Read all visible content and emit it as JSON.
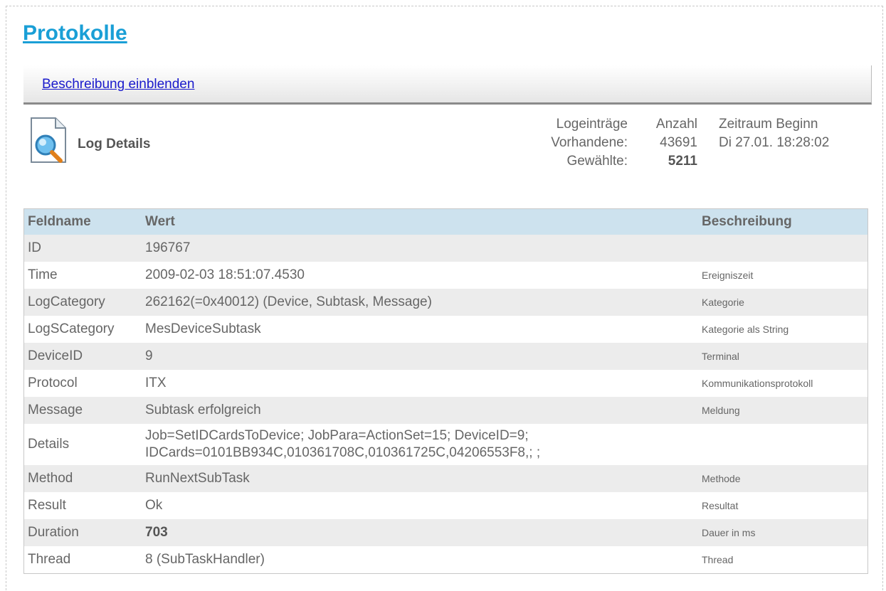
{
  "page": {
    "title": "Protokolle"
  },
  "description_toggle": {
    "label": "Beschreibung einblenden"
  },
  "log_details": {
    "title": "Log Details"
  },
  "stats": {
    "logeintraege_header": "Logeinträge",
    "anzahl_header": "Anzahl",
    "zeitraum_header": "Zeitraum Beginn",
    "vorhandene_label": "Vorhandene:",
    "vorhandene_count": "43691",
    "zeitraum_value": "Di 27.01. 18:28:02",
    "gewaehlte_label": "Gewählte:",
    "gewaehlte_count": "5211"
  },
  "table": {
    "headers": [
      "Feldname",
      "Wert",
      "Beschreibung"
    ],
    "rows": [
      {
        "field": "ID",
        "value": "196767",
        "description": ""
      },
      {
        "field": "Time",
        "value": "2009-02-03 18:51:07.4530",
        "description": "Ereigniszeit"
      },
      {
        "field": "LogCategory",
        "value": "262162(=0x40012) (Device, Subtask, Message)",
        "description": "Kategorie"
      },
      {
        "field": "LogSCategory",
        "value": "MesDeviceSubtask",
        "description": "Kategorie als String"
      },
      {
        "field": "DeviceID",
        "value": "9",
        "description": "Terminal"
      },
      {
        "field": "Protocol",
        "value": "ITX",
        "description": "Kommunikationsprotokoll"
      },
      {
        "field": "Message",
        "value": "Subtask erfolgreich",
        "description": "Meldung"
      },
      {
        "field": "Details",
        "value_line1": "Job=SetIDCardsToDevice; JobPara=ActionSet=15; DeviceID=9;",
        "value_line2": "IDCards=0101BB934C,010361708C,010361725C,04206553F8,; ;",
        "description": ""
      },
      {
        "field": "Method",
        "value": "RunNextSubTask",
        "description": "Methode"
      },
      {
        "field": "Result",
        "value": "Ok",
        "description": "Resultat"
      },
      {
        "field": "Duration",
        "value": "703",
        "description": "Dauer in ms"
      },
      {
        "field": "Thread",
        "value": "8 (SubTaskHandler)",
        "description": "Thread"
      }
    ]
  },
  "icons": {
    "log": "document-magnifier-icon"
  }
}
